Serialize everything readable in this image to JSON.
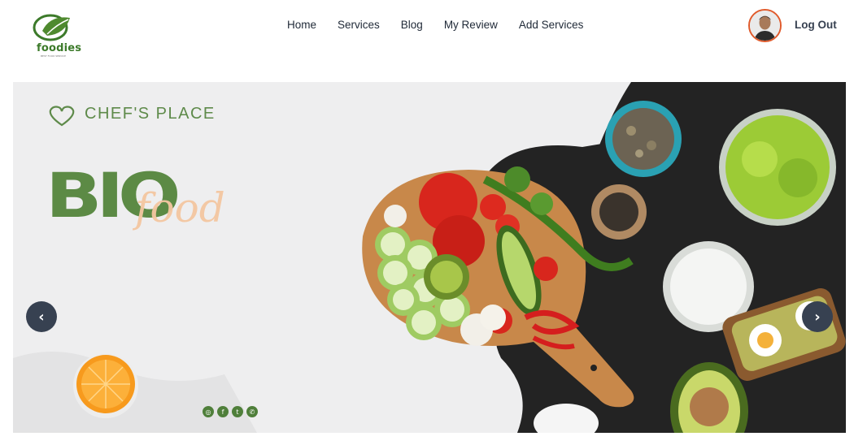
{
  "brand": {
    "name": "foodies",
    "tagline": "BEST FOOD SERVICE"
  },
  "nav": {
    "items": [
      {
        "label": "Home"
      },
      {
        "label": "Services"
      },
      {
        "label": "Blog"
      },
      {
        "label": "My Review"
      },
      {
        "label": "Add Services"
      }
    ]
  },
  "user": {
    "logout_label": "Log Out"
  },
  "hero": {
    "kicker": "CHEF'S PLACE",
    "title": "BIO",
    "script": "food",
    "prev_label": "‹",
    "next_label": "›"
  },
  "socials": [
    {
      "icon": "instagram-icon",
      "glyph": "◎"
    },
    {
      "icon": "facebook-icon",
      "glyph": "f"
    },
    {
      "icon": "twitter-icon",
      "glyph": "t"
    },
    {
      "icon": "whatsapp-icon",
      "glyph": "✆"
    }
  ],
  "colors": {
    "brand_green": "#5c8a45",
    "accent_orange": "#e05a2b",
    "nav_text": "#1f2937",
    "arrow_bg": "#374151"
  }
}
